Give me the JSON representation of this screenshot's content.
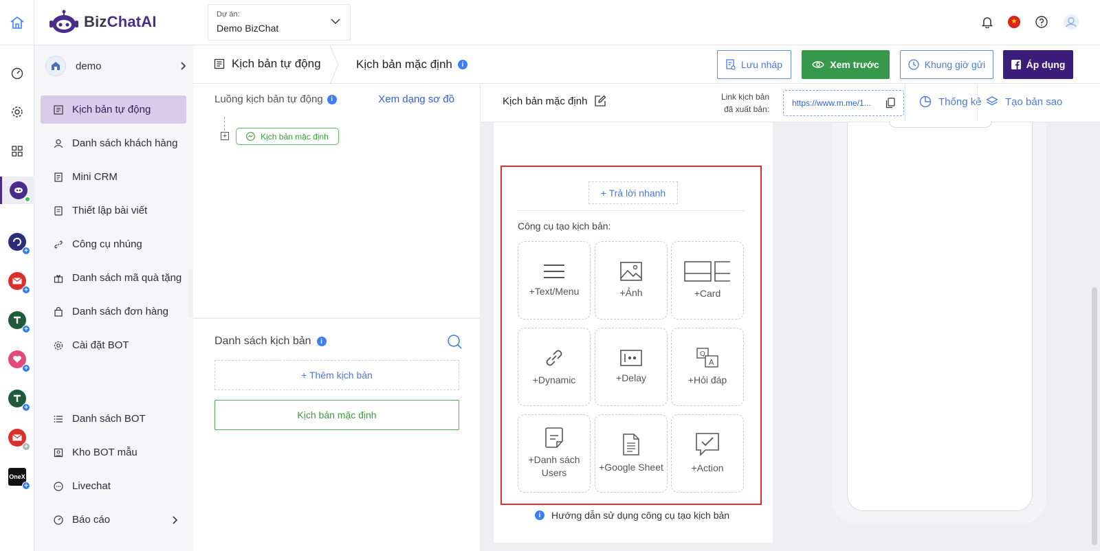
{
  "app": {
    "logo_biz": "Biz",
    "logo_chat": "ChatAI"
  },
  "project": {
    "label": "Dự án:",
    "value": "Demo BizChat"
  },
  "header_icons": [
    "bell-icon",
    "vietnam-flag-icon",
    "help-icon",
    "user-avatar-icon"
  ],
  "rail": {
    "items": [
      "dashboard-icon",
      "settings-icon",
      "apps-icon",
      "bizchat-app-icon",
      "app-1-icon",
      "app-mail-icon",
      "app-t-icon",
      "app-heart-icon",
      "app-t2-icon",
      "app-mail2-icon",
      "app-onex-icon"
    ],
    "onex_label": "OneX"
  },
  "sidebar": {
    "bot_name": "demo",
    "items": [
      {
        "label": "Kịch bản tự động",
        "icon": "script-icon",
        "active": true
      },
      {
        "label": "Danh sách khách hàng",
        "icon": "user-icon"
      },
      {
        "label": "Mini CRM",
        "icon": "crm-icon"
      },
      {
        "label": "Thiết lập bài viết",
        "icon": "post-icon"
      },
      {
        "label": "Công cụ nhúng",
        "icon": "link-icon"
      },
      {
        "label": "Danh sách mã quà tặng",
        "icon": "gift-icon"
      },
      {
        "label": "Danh sách đơn hàng",
        "icon": "bag-icon"
      },
      {
        "label": "Cài đặt BOT",
        "icon": "gear-icon"
      },
      {
        "label": "Danh sách BOT",
        "icon": "list-icon"
      },
      {
        "label": "Kho BOT mẫu",
        "icon": "template-icon"
      },
      {
        "label": "Livechat",
        "icon": "chat-icon"
      },
      {
        "label": "Báo cáo",
        "icon": "report-icon",
        "has_submenu": true
      }
    ]
  },
  "breadcrumb": {
    "first": "Kịch bản tự động",
    "second": "Kịch bản mặc định",
    "info": "i"
  },
  "toolbar": {
    "draft": "Lưu nháp",
    "preview": "Xem trước",
    "schedule": "Khung giờ gửi",
    "apply": "Áp dụng",
    "apply_color": "#3a1e7a",
    "preview_color": "#35984a"
  },
  "flow": {
    "title": "Luồng kịch bản tự động",
    "view_diagram": "Xem dạng sơ đồ",
    "node": "Kịch bản mặc định"
  },
  "script_list": {
    "title": "Danh sách kịch bản",
    "add": "+ Thêm kịch bản",
    "default": "Kịch bản mặc định"
  },
  "editor": {
    "title": "Kịch bản mặc định",
    "link_label_1": "Link kịch bản",
    "link_label_2": "đã xuất bản:",
    "link_value": "https://www.m.me/1...",
    "stats": "Thống kê",
    "duplicate": "Tạo bản sao"
  },
  "tools": {
    "quick_reply": "+ Trả lời nhanh",
    "label": "Công cụ tạo kịch bản:",
    "items": [
      {
        "label": "+Text/Menu",
        "icon": "text-menu-icon"
      },
      {
        "label": "+Ảnh",
        "icon": "image-icon"
      },
      {
        "label": "+Card",
        "icon": "card-icon"
      },
      {
        "label": "+Dynamic",
        "icon": "dynamic-link-icon"
      },
      {
        "label": "+Delay",
        "icon": "delay-icon"
      },
      {
        "label": "+Hỏi đáp",
        "icon": "qa-icon"
      },
      {
        "label": "+Danh sách Users",
        "icon": "user-list-icon"
      },
      {
        "label": "+Google Sheet",
        "icon": "google-sheet-icon"
      },
      {
        "label": "+Action",
        "icon": "action-icon"
      }
    ],
    "highlight_color": "#e0302a"
  },
  "guide": "Hướng dẫn sử dụng công cụ tạo kịch bản"
}
